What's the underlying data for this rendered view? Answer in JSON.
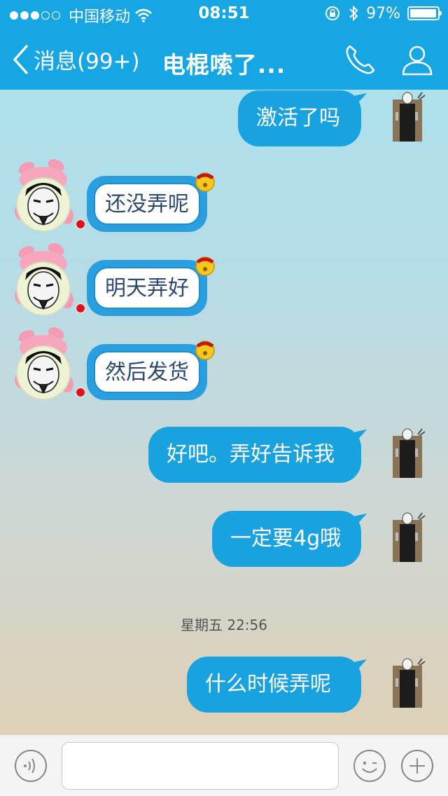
{
  "status_bar": {
    "signal_dots_filled": 3,
    "signal_dots_empty": 2,
    "carrier": "中国移动",
    "time": "08:51",
    "battery_percent": "97%",
    "battery_level": 0.97,
    "icons": [
      "wifi-icon",
      "rotation-lock-icon",
      "bluetooth-icon",
      "battery-icon"
    ]
  },
  "nav": {
    "back_label": "消息(99+)",
    "title": "电棍嗦了...",
    "right_icons": [
      "phone-icon",
      "profile-icon"
    ]
  },
  "messages": [
    {
      "side": "right",
      "text": "激活了吗"
    },
    {
      "side": "left",
      "text": "还没弄呢"
    },
    {
      "side": "left",
      "text": "明天弄好"
    },
    {
      "side": "left",
      "text": "然后发货"
    },
    {
      "side": "right",
      "text": "好吧。弄好告诉我"
    },
    {
      "side": "right",
      "text": "一定要4g哦"
    },
    {
      "side": "right",
      "text": "什么时候弄呢"
    }
  ],
  "timestamp": "星期五 22:56",
  "input_bar": {
    "icons": [
      "voice-icon",
      "emoji-icon",
      "plus-icon"
    ],
    "value": "",
    "placeholder": ""
  },
  "colors": {
    "header": "#16a6e4",
    "bubble_out": "#19a2e0",
    "bubble_in_frame": "#2a9fe0",
    "bubble_in_text": "#2c4870",
    "unread_dot": "#e3101a"
  }
}
